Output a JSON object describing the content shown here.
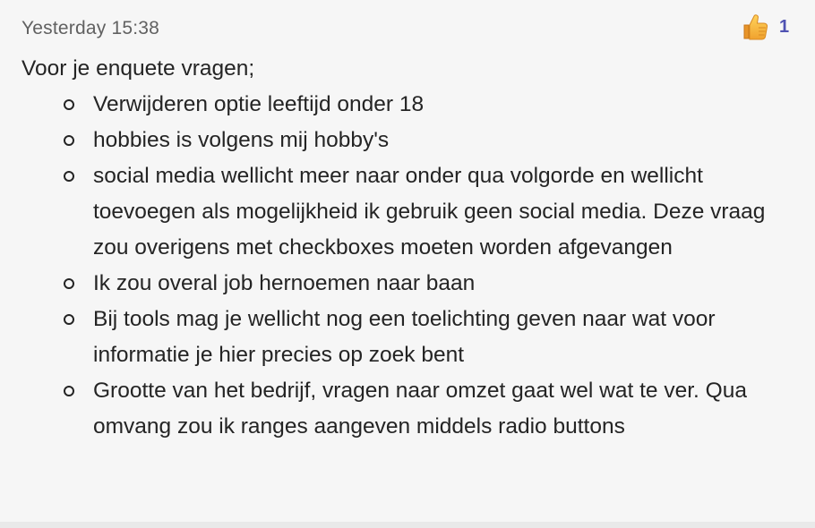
{
  "message": {
    "timestamp": "Yesterday 15:38",
    "reaction": {
      "icon": "thumbs-up-icon",
      "count": "1",
      "count_color": "#4f52b2"
    },
    "intro": "Voor je enquete vragen;",
    "items": [
      "Verwijderen optie leeftijd onder 18",
      "hobbies is volgens mij hobby's",
      "social media wellicht meer naar onder qua volgorde en wellicht toevoegen als mogelijkheid ik gebruik geen social media. Deze vraag zou overigens met checkboxes moeten worden afgevangen",
      "Ik zou overal job hernoemen naar baan",
      "Bij tools mag je wellicht nog een toelichting geven naar wat voor informatie je hier precies op zoek bent",
      "Grootte van het bedrijf, vragen naar omzet gaat wel wat te ver. Qua omvang zou ik ranges aangeven middels radio buttons"
    ]
  }
}
